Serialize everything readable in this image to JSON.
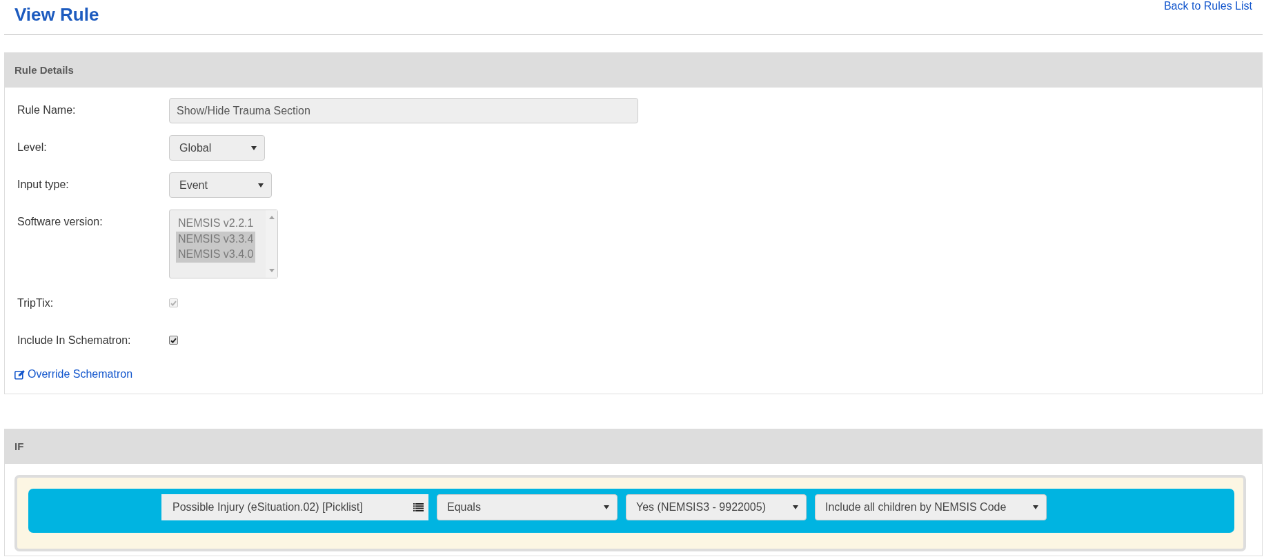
{
  "page": {
    "title": "View Rule",
    "back_link": "Back to Rules List"
  },
  "rule_details": {
    "title": "Rule Details",
    "fields": [
      {
        "kind": "text",
        "label": "Rule Name:",
        "value": "Show/Hide Trauma Section"
      },
      {
        "kind": "select",
        "label": "Level:",
        "value": "Global"
      },
      {
        "kind": "select",
        "label": "Input type:",
        "value": "Event"
      },
      {
        "kind": "listbox",
        "label": "Software version:",
        "options": [
          {
            "label": "NEMSIS v2.2.1",
            "selected": false
          },
          {
            "label": "NEMSIS v3.3.4",
            "selected": true
          },
          {
            "label": "NEMSIS v3.4.0",
            "selected": true
          }
        ]
      },
      {
        "kind": "checkbox",
        "label": "TripTix:",
        "checked": true,
        "disabled": true
      },
      {
        "kind": "checkbox",
        "label": "Include In Schematron:",
        "checked": true,
        "disabled": false
      }
    ],
    "override_link": "Override Schematron"
  },
  "if_section": {
    "title": "IF",
    "condition": {
      "field": "Possible Injury (eSituation.02) [Picklist]",
      "dropdowns": [
        "Equals",
        "Yes (NEMSIS3 - 9922005)",
        "Include all children by NEMSIS Code"
      ]
    }
  }
}
